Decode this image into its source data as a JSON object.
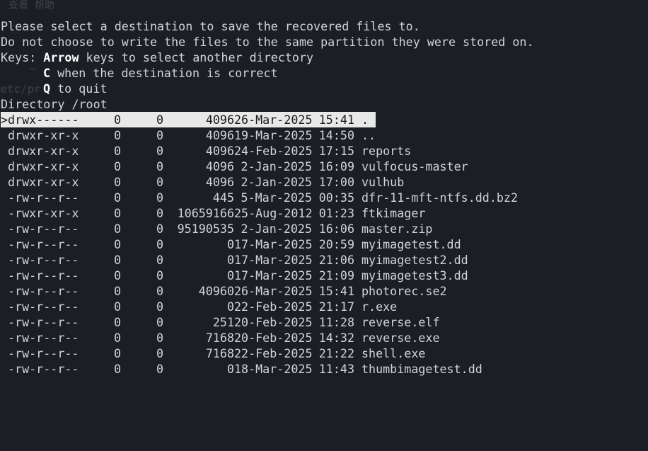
{
  "ghost": {
    "menu": "查看  帮助",
    "tilde": "~",
    "etc": "etc/pr"
  },
  "prompt": {
    "line1": "Please select a destination to save the recovered files to.",
    "line2": "Do not choose to write the files to the same partition they were stored on.",
    "keys_prefix": "Keys: ",
    "arrow_key": "Arrow",
    "arrow_desc": " keys to select another directory",
    "c_key": "C",
    "c_desc": " when the destination is correct",
    "q_key": "Q",
    "q_desc": " to quit",
    "directory": "Directory /root"
  },
  "entries": [
    {
      "perm": ">drwx------",
      "uid": "0",
      "gid": "0",
      "size": "4096",
      "date": "26-Mar-2025",
      "time": "15:41",
      "name": ".",
      "selected": true
    },
    {
      "perm": "drwxr-xr-x",
      "uid": "0",
      "gid": "0",
      "size": "4096",
      "date": "19-Mar-2025",
      "time": "14:50",
      "name": ".."
    },
    {
      "perm": "drwxr-xr-x",
      "uid": "0",
      "gid": "0",
      "size": "4096",
      "date": "24-Feb-2025",
      "time": "17:15",
      "name": "reports"
    },
    {
      "perm": "drwxr-xr-x",
      "uid": "0",
      "gid": "0",
      "size": "4096",
      "date": "2-Jan-2025",
      "time": "16:09",
      "name": "vulfocus-master"
    },
    {
      "perm": "drwxr-xr-x",
      "uid": "0",
      "gid": "0",
      "size": "4096",
      "date": "2-Jan-2025",
      "time": "17:00",
      "name": "vulhub"
    },
    {
      "perm": "-rw-r--r--",
      "uid": "0",
      "gid": "0",
      "size": "445",
      "date": "5-Mar-2025",
      "time": "00:35",
      "name": "dfr-11-mft-ntfs.dd.bz2"
    },
    {
      "perm": "-rwxr-xr-x",
      "uid": "0",
      "gid": "0",
      "size": "10659166",
      "date": "25-Aug-2012",
      "time": "01:23",
      "name": "ftkimager"
    },
    {
      "perm": "-rw-r--r--",
      "uid": "0",
      "gid": "0",
      "size": "95190535",
      "date": "2-Jan-2025",
      "time": "16:06",
      "name": "master.zip"
    },
    {
      "perm": "-rw-r--r--",
      "uid": "0",
      "gid": "0",
      "size": "0",
      "date": "17-Mar-2025",
      "time": "20:59",
      "name": "myimagetest.dd"
    },
    {
      "perm": "-rw-r--r--",
      "uid": "0",
      "gid": "0",
      "size": "0",
      "date": "17-Mar-2025",
      "time": "21:06",
      "name": "myimagetest2.dd"
    },
    {
      "perm": "-rw-r--r--",
      "uid": "0",
      "gid": "0",
      "size": "0",
      "date": "17-Mar-2025",
      "time": "21:09",
      "name": "myimagetest3.dd"
    },
    {
      "perm": "-rw-r--r--",
      "uid": "0",
      "gid": "0",
      "size": "40960",
      "date": "26-Mar-2025",
      "time": "15:41",
      "name": "photorec.se2"
    },
    {
      "perm": "-rw-r--r--",
      "uid": "0",
      "gid": "0",
      "size": "0",
      "date": "22-Feb-2025",
      "time": "21:17",
      "name": "r.exe"
    },
    {
      "perm": "-rw-r--r--",
      "uid": "0",
      "gid": "0",
      "size": "251",
      "date": "20-Feb-2025",
      "time": "11:28",
      "name": "reverse.elf"
    },
    {
      "perm": "-rw-r--r--",
      "uid": "0",
      "gid": "0",
      "size": "7168",
      "date": "20-Feb-2025",
      "time": "14:32",
      "name": "reverse.exe"
    },
    {
      "perm": "-rw-r--r--",
      "uid": "0",
      "gid": "0",
      "size": "7168",
      "date": "22-Feb-2025",
      "time": "21:22",
      "name": "shell.exe"
    },
    {
      "perm": "-rw-r--r--",
      "uid": "0",
      "gid": "0",
      "size": "0",
      "date": "18-Mar-2025",
      "time": "11:43",
      "name": "thumbimagetest.dd"
    }
  ],
  "colors": {
    "background": "#1c1e26",
    "text": "#d4d4d6",
    "selection_bg": "#e8e8e8",
    "selection_fg": "#1a1a1a",
    "key_highlight": "#ffffff"
  }
}
